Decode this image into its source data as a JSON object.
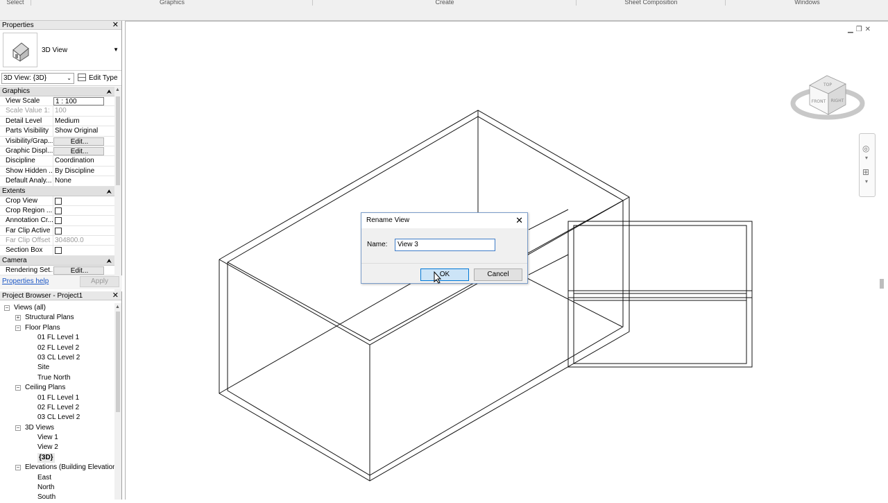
{
  "ribbon": {
    "panels": [
      "Select",
      "Graphics",
      "Create",
      "Sheet Composition",
      "Windows"
    ]
  },
  "properties": {
    "title": "Properties",
    "type_name": "3D View",
    "instance_selector": "3D View: {3D}",
    "edit_type_label": "Edit Type",
    "groups": {
      "graphics": "Graphics",
      "extents": "Extents",
      "camera": "Camera"
    },
    "rows": {
      "view_scale": {
        "k": "View Scale",
        "v": "1 : 100"
      },
      "scale_value": {
        "k": "Scale Value    1:",
        "v": "100"
      },
      "detail_level": {
        "k": "Detail Level",
        "v": "Medium"
      },
      "parts_visibility": {
        "k": "Parts Visibility",
        "v": "Show Original"
      },
      "visibility_graphics": {
        "k": "Visibility/Grap...",
        "v": "Edit..."
      },
      "graphic_display": {
        "k": "Graphic Displ...",
        "v": "Edit..."
      },
      "discipline": {
        "k": "Discipline",
        "v": "Coordination"
      },
      "show_hidden": {
        "k": "Show Hidden ...",
        "v": "By Discipline"
      },
      "default_analysis": {
        "k": "Default Analy...",
        "v": "None"
      },
      "crop_view": {
        "k": "Crop View",
        "checked": false
      },
      "crop_region": {
        "k": "Crop Region ...",
        "checked": false
      },
      "annotation_crop": {
        "k": "Annotation Cr...",
        "checked": false
      },
      "far_clip_active": {
        "k": "Far Clip Active",
        "checked": false
      },
      "far_clip_offset": {
        "k": "Far Clip Offset",
        "v": "304800.0"
      },
      "section_box": {
        "k": "Section Box",
        "checked": false
      },
      "rendering_settings": {
        "k": "Rendering Set...",
        "v": "Edit..."
      }
    },
    "help_link": "Properties help",
    "apply_label": "Apply"
  },
  "browser": {
    "title": "Project Browser - Project1",
    "items": [
      {
        "label": "Views (all)",
        "level": 0,
        "exp": "-"
      },
      {
        "label": "Structural Plans",
        "level": 1,
        "exp": "+"
      },
      {
        "label": "Floor Plans",
        "level": 1,
        "exp": "-"
      },
      {
        "label": "01 FL Level 1",
        "level": 2
      },
      {
        "label": "02 FL Level 2",
        "level": 2
      },
      {
        "label": "03 CL Level 2",
        "level": 2
      },
      {
        "label": "Site",
        "level": 2
      },
      {
        "label": "True North",
        "level": 2
      },
      {
        "label": "Ceiling Plans",
        "level": 1,
        "exp": "-"
      },
      {
        "label": "01 FL Level 1",
        "level": 2
      },
      {
        "label": "02 FL Level 2",
        "level": 2
      },
      {
        "label": "03 CL Level 2",
        "level": 2
      },
      {
        "label": "3D Views",
        "level": 1,
        "exp": "-"
      },
      {
        "label": "View 1",
        "level": 2
      },
      {
        "label": "View 2",
        "level": 2
      },
      {
        "label": "{3D}",
        "level": 2,
        "selected": true
      },
      {
        "label": "Elevations (Building Elevation)",
        "level": 1,
        "exp": "-"
      },
      {
        "label": "East",
        "level": 2
      },
      {
        "label": "North",
        "level": 2
      },
      {
        "label": "South",
        "level": 2
      }
    ]
  },
  "viewcube": {
    "top": "TOP",
    "front": "FRONT",
    "right": "RIGHT"
  },
  "dialog": {
    "title": "Rename View",
    "name_label": "Name:",
    "name_value": "View 3",
    "ok_label": "OK",
    "cancel_label": "Cancel"
  }
}
